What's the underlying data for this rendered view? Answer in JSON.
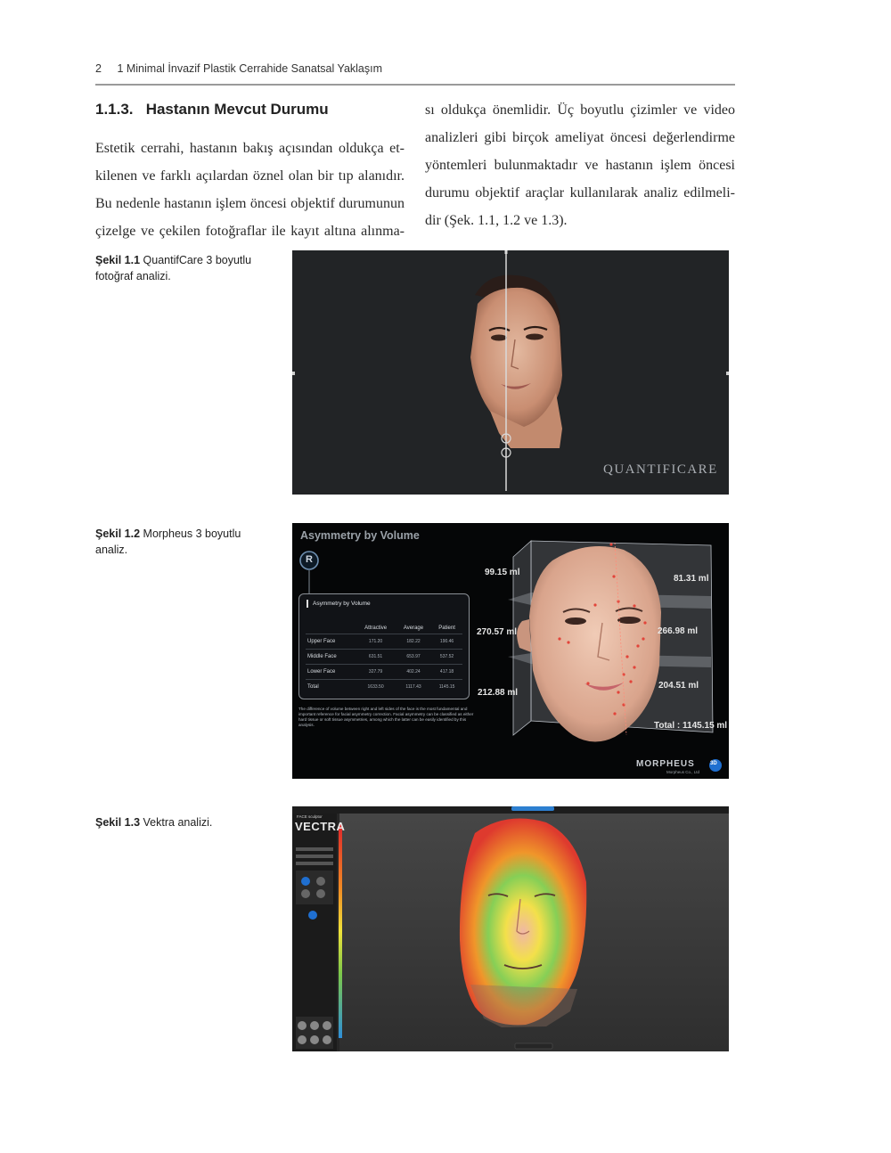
{
  "header": {
    "page_number": "2",
    "running_title": "1 Minimal İnvazif Plastik Cerrahide Sanatsal Yaklaşım"
  },
  "section": {
    "heading": "1.1.3.   Hastanın Mevcut Durumu",
    "left_lines": [
      "Estetik cerrahi, hastanın bakış açısından oldukça et-",
      "kilenen ve farklı açılardan öznel olan bir tıp alanıdır.",
      "Bu nedenle hastanın işlem öncesi objektif durumunun",
      "çizelge ve çekilen fotoğraflar ile kayıt altına alınma-"
    ],
    "right_lines": [
      "sı oldukça önemlidir. Üç boyutlu çizimler ve video",
      "analizleri gibi birçok ameliyat öncesi değerlendirme",
      "yöntemleri bulunmaktadır ve hastanın işlem öncesi",
      "durumu objektif araçlar kullanılarak analiz edilmeli-",
      "dir (Şek. 1.1, 1.2 ve 1.3)."
    ]
  },
  "figures": [
    {
      "label": "Şekil 1.1",
      "caption": "QuantifCare 3 boyutlu fotoğraf analizi.",
      "logo": "QUANTIFICARE"
    },
    {
      "label": "Şekil 1.2",
      "caption": "Morpheus 3 boyutlu analiz.",
      "screen_title": "Asymmetry by Volume",
      "side_badge": "R",
      "panel_title": "Asymmetry by Volume",
      "table": {
        "columns": [
          "",
          "Attractive",
          "Average",
          "Patient"
        ],
        "rows": [
          [
            "Upper Face",
            "171.20",
            "182.22",
            "190.46"
          ],
          [
            "Middle Face",
            "631.51",
            "653.97",
            "537.52"
          ],
          [
            "Lower Face",
            "327.79",
            "402.24",
            "417.18"
          ],
          [
            "Total",
            "1633.50",
            "1117.43",
            "1145.15"
          ]
        ]
      },
      "note": "The difference of volume between right and left sides of the face is the most fundamental and important reference for facial asymmetry correction. Facial asymmetry can be classified as either hard tissue or soft tissue asymmetries, among which the latter can be easily identified by this analysis.",
      "volumes": {
        "left_top": "99.15 ml",
        "left_mid": "270.57 ml",
        "left_low": "212.88 ml",
        "right_top": "81.31 ml",
        "right_mid": "266.98 ml",
        "right_low": "204.51 ml",
        "total": "Total : 1145.15 ml"
      },
      "logo": "MORPHEUS",
      "logo_badge": "3D",
      "logo_sub": "Morpheus Co., Ltd"
    },
    {
      "label": "Şekil 1.3",
      "caption": "Vektra analizi.",
      "logo": "VECTRA",
      "logo_top": "FACE sculptor"
    }
  ],
  "colors": {
    "rule": "#9a9a9a",
    "morpheus_bg": "#050607",
    "quantificare_bg": "#222426",
    "vectra_bg": "#3a3a3a"
  }
}
